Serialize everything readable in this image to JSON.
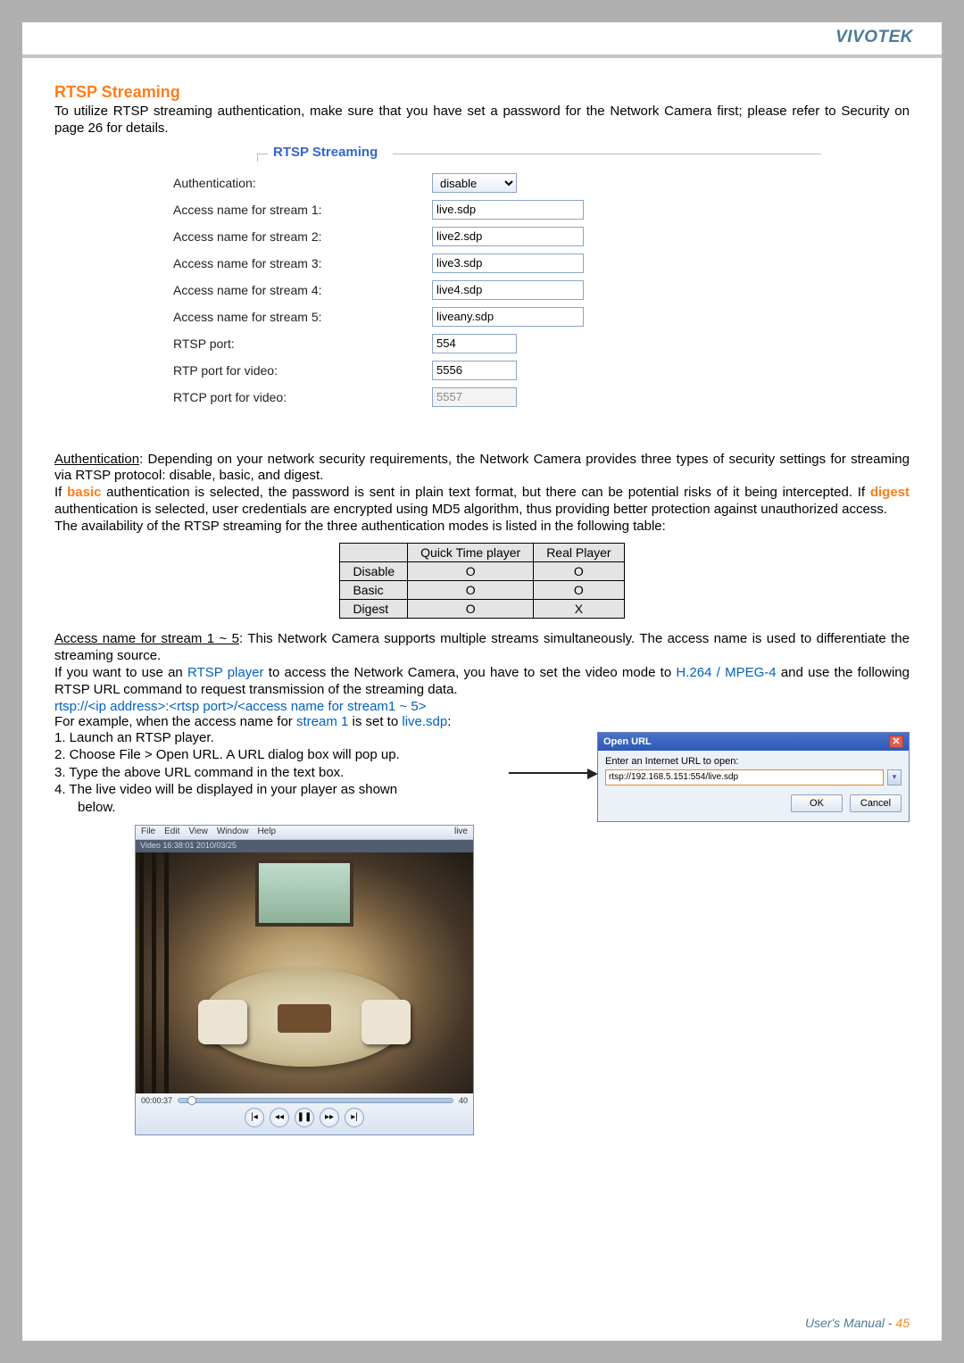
{
  "brand": "VIVOTEK",
  "section_title": "RTSP Streaming",
  "intro": "To utilize RTSP streaming authentication, make sure that you have set a password for the Network Camera first; please refer to Security on page 26 for details.",
  "panel_legend": "RTSP Streaming",
  "fields": {
    "auth_label": "Authentication:",
    "auth_value": "disable",
    "s1_label": "Access name for stream 1:",
    "s1_value": "live.sdp",
    "s2_label": "Access name for stream 2:",
    "s2_value": "live2.sdp",
    "s3_label": "Access name for stream 3:",
    "s3_value": "live3.sdp",
    "s4_label": "Access name for stream 4:",
    "s4_value": "live4.sdp",
    "s5_label": "Access name for stream 5:",
    "s5_value": "liveany.sdp",
    "rtsp_label": "RTSP port:",
    "rtsp_value": "554",
    "rtp_label": "RTP port for video:",
    "rtp_value": "5556",
    "rtcp_label": "RTCP port for video:",
    "rtcp_value": "5557"
  },
  "auth_heading": "Authentication",
  "auth_text1": ": Depending on your network security requirements, the Network Camera provides three types of security settings for streaming via RTSP protocol: disable, basic, and digest.",
  "auth_text2a": "If ",
  "auth_text2_basic": "basic",
  "auth_text2b": " authentication is selected, the password is sent in plain text format, but there can be potential risks of it being intercepted. If ",
  "auth_text2_digest": "digest",
  "auth_text2c": " authentication is selected, user credentials are encrypted using MD5 algorithm, thus providing better protection against unauthorized access.",
  "auth_text3": "The availability of the RTSP streaming for the three authentication modes is listed in the following table:",
  "compat": {
    "col1": "Quick Time player",
    "col2": "Real Player",
    "r1": "Disable",
    "r1a": "O",
    "r1b": "O",
    "r2": "Basic",
    "r2a": "O",
    "r2b": "O",
    "r3": "Digest",
    "r3a": "O",
    "r3b": "X"
  },
  "access_heading": "Access name for stream 1 ~ 5",
  "access_text": ": This Network Camera supports multiple streams simultaneously. The access name is used to differentiate the streaming source.",
  "rtsp_line1a": "If you want to use an ",
  "rtsp_player": "RTSP player",
  "rtsp_line1b": " to access the Network Camera, you have to set the video mode to ",
  "rtsp_codec": "H.264 / MPEG-4",
  "rtsp_line1c": " and use the following RTSP URL command to request transmission of the streaming data.",
  "rtsp_url_tpl": "rtsp://<ip address>:<rtsp port>/<access name for stream1 ~ 5>",
  "example_a": "For example, when the access name for ",
  "example_stream": "stream 1",
  "example_b": " is set to ",
  "example_sdp": "live.sdp",
  "example_c": ":",
  "steps": {
    "s1": "1. Launch an RTSP player.",
    "s2": "2. Choose File > Open URL. A URL dialog box will pop up.",
    "s3": "3. Type the above URL command in the text box.",
    "s4a": "4. The live video will be displayed in your player as shown",
    "s4b": "below."
  },
  "dialog": {
    "title": "Open URL",
    "label": "Enter an Internet URL to open:",
    "value": "rtsp://192.168.5.151:554/live.sdp",
    "ok": "OK",
    "cancel": "Cancel"
  },
  "player": {
    "menu": [
      "File",
      "Edit",
      "View",
      "Window",
      "Help"
    ],
    "tbar_title": "live",
    "timestamp": "Video 16:38:01 2010/03/25",
    "pos": "00:00:37",
    "vol": "40"
  },
  "footer_text": "User's Manual - ",
  "footer_page": "45"
}
